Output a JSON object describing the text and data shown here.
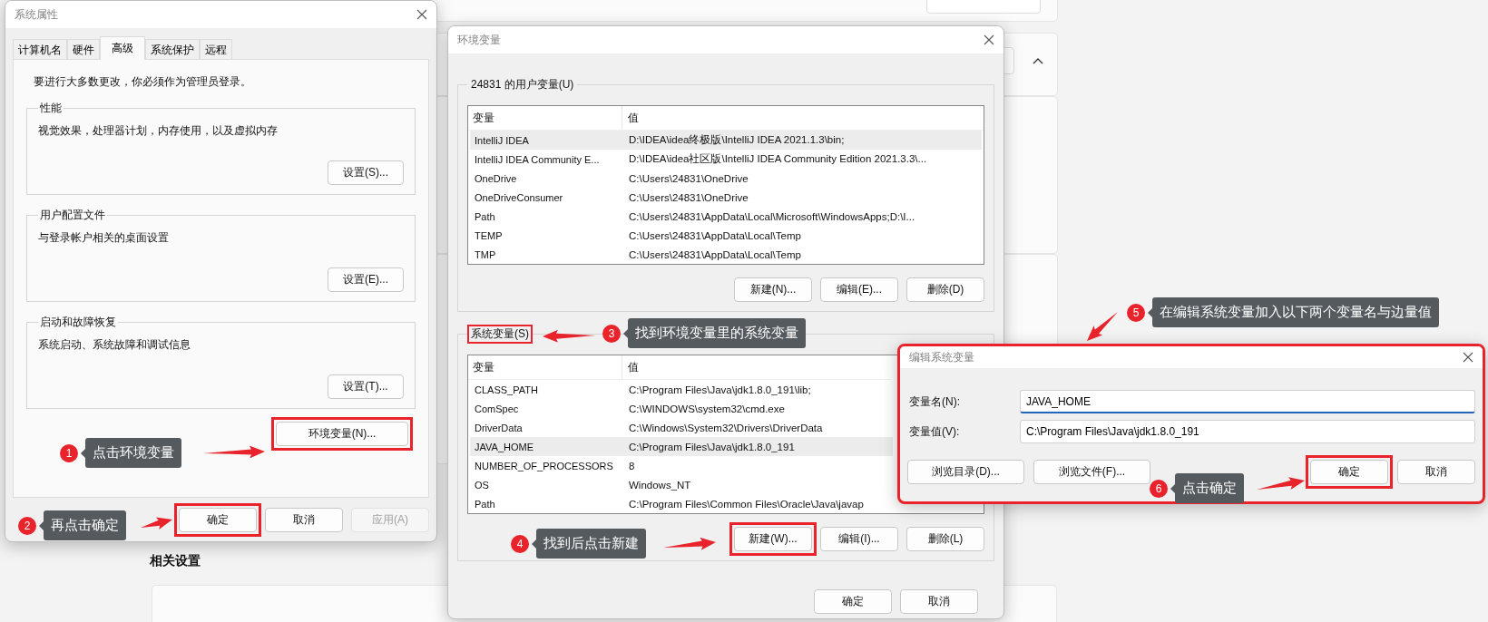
{
  "settings_page": {
    "section_title": "相关设置"
  },
  "system_properties": {
    "title": "系统属性",
    "tabs": [
      {
        "label": "计算机名",
        "selected": false
      },
      {
        "label": "硬件",
        "selected": false
      },
      {
        "label": "高级",
        "selected": true
      },
      {
        "label": "系统保护",
        "selected": false
      },
      {
        "label": "远程",
        "selected": false
      }
    ],
    "notice": "要进行大多数更改，你必须作为管理员登录。",
    "groups": [
      {
        "title": "性能",
        "description": "视觉效果，处理器计划，内存使用，以及虚拟内存",
        "button": "设置(S)..."
      },
      {
        "title": "用户配置文件",
        "description": "与登录帐户相关的桌面设置",
        "button": "设置(E)..."
      },
      {
        "title": "启动和故障恢复",
        "description": "系统启动、系统故障和调试信息",
        "button": "设置(T)..."
      }
    ],
    "env_button": {
      "label": "环境变量(N)...",
      "highlighted": true
    },
    "buttons": [
      {
        "label": "确定",
        "disabled": false,
        "highlighted": true
      },
      {
        "label": "取消",
        "disabled": false,
        "highlighted": false
      },
      {
        "label": "应用(A)",
        "disabled": true,
        "highlighted": false
      }
    ]
  },
  "environment_variables": {
    "title": "环境变量",
    "user_group": {
      "title": "24831 的用户变量(U)",
      "highlighted": false,
      "columns": [
        "变量",
        "值"
      ],
      "rows": [
        {
          "name": "IntelliJ IDEA",
          "value": "D:\\IDEA\\idea终极版\\IntelliJ IDEA 2021.1.3\\bin;",
          "selected": true
        },
        {
          "name": "IntelliJ IDEA Community E...",
          "value": "D:\\IDEA\\idea社区版\\IntelliJ IDEA Community Edition 2021.3.3\\...",
          "selected": false
        },
        {
          "name": "OneDrive",
          "value": "C:\\Users\\24831\\OneDrive",
          "selected": false
        },
        {
          "name": "OneDriveConsumer",
          "value": "C:\\Users\\24831\\OneDrive",
          "selected": false
        },
        {
          "name": "Path",
          "value": "C:\\Users\\24831\\AppData\\Local\\Microsoft\\WindowsApps;D:\\I...",
          "selected": false
        },
        {
          "name": "TEMP",
          "value": "C:\\Users\\24831\\AppData\\Local\\Temp",
          "selected": false
        },
        {
          "name": "TMP",
          "value": "C:\\Users\\24831\\AppData\\Local\\Temp",
          "selected": false
        }
      ],
      "buttons": [
        {
          "label": "新建(N)...",
          "highlighted": false
        },
        {
          "label": "编辑(E)...",
          "highlighted": false
        },
        {
          "label": "删除(D)",
          "highlighted": false
        }
      ]
    },
    "system_group": {
      "title": "系统变量(S)",
      "highlighted": true,
      "columns": [
        "变量",
        "值"
      ],
      "rows": [
        {
          "name": "CLASS_PATH",
          "value": "C:\\Program Files\\Java\\jdk1.8.0_191\\lib;",
          "selected": false
        },
        {
          "name": "ComSpec",
          "value": "C:\\WINDOWS\\system32\\cmd.exe",
          "selected": false
        },
        {
          "name": "DriverData",
          "value": "C:\\Windows\\System32\\Drivers\\DriverData",
          "selected": false
        },
        {
          "name": "JAVA_HOME",
          "value": "C:\\Program Files\\Java\\jdk1.8.0_191",
          "selected": true
        },
        {
          "name": "NUMBER_OF_PROCESSORS",
          "value": "8",
          "selected": false
        },
        {
          "name": "OS",
          "value": "Windows_NT",
          "selected": false
        },
        {
          "name": "Path",
          "value": "C:\\Program Files\\Common Files\\Oracle\\Java\\javap",
          "selected": false
        }
      ],
      "buttons": [
        {
          "label": "新建(W)...",
          "highlighted": true
        },
        {
          "label": "编辑(I)...",
          "highlighted": false
        },
        {
          "label": "删除(L)",
          "highlighted": false
        }
      ]
    },
    "buttons": [
      {
        "label": "确定",
        "highlighted": false
      },
      {
        "label": "取消",
        "highlighted": false
      }
    ]
  },
  "edit_dialog": {
    "title": "编辑系统变量",
    "highlighted": true,
    "fields": [
      {
        "label": "变量名(N):",
        "value": "JAVA_HOME",
        "focused": true
      },
      {
        "label": "变量值(V):",
        "value": "C:\\Program Files\\Java\\jdk1.8.0_191",
        "focused": false
      }
    ],
    "browse_buttons": [
      {
        "label": "浏览目录(D)...",
        "highlighted": false
      },
      {
        "label": "浏览文件(F)...",
        "highlighted": false
      }
    ],
    "buttons": [
      {
        "label": "确定",
        "highlighted": true
      },
      {
        "label": "取消",
        "highlighted": false
      }
    ]
  },
  "annotations": [
    {
      "number": "1",
      "text": "点击环境变量"
    },
    {
      "number": "2",
      "text": "再点击确定"
    },
    {
      "number": "3",
      "text": "找到环境变量里的系统变量"
    },
    {
      "number": "4",
      "text": "找到后点击新建"
    },
    {
      "number": "5",
      "text": "在编辑系统变量加入以下两个变量名与边量值"
    },
    {
      "number": "6",
      "text": "点击确定"
    }
  ]
}
